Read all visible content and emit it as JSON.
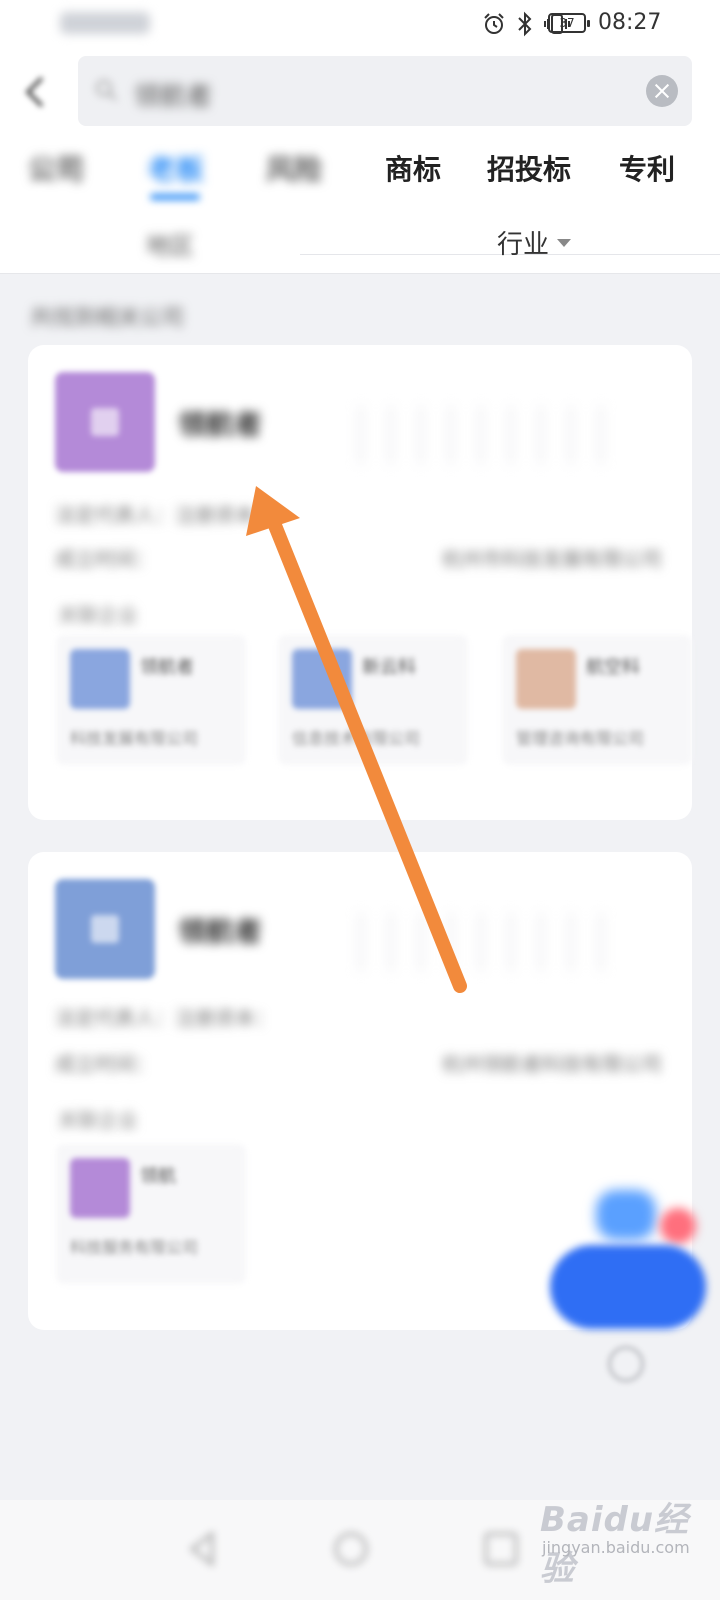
{
  "status_bar": {
    "time": "08:27",
    "battery": "37"
  },
  "search": {
    "query": "领航者"
  },
  "tabs": [
    {
      "label": "公司"
    },
    {
      "label": "老板"
    },
    {
      "label": "风险"
    },
    {
      "label": "商标"
    },
    {
      "label": "招投标"
    },
    {
      "label": "专利"
    }
  ],
  "filters": {
    "region": "地区",
    "industry": "行业"
  },
  "result_summary": "共找到相关公司",
  "cards": [
    {
      "name": "领航者",
      "line1": "法定代表人：注册资本：",
      "line2": "成立时间：",
      "line2_right": "杭州市科技发展有限公司",
      "section": "关联企业",
      "minis": [
        {
          "title": "领航者",
          "desc": "科技发展有限公司"
        },
        {
          "title": "新云科",
          "desc": "信息技术有限公司"
        },
        {
          "title": "航空科",
          "desc": "管理咨询有限公司"
        }
      ]
    },
    {
      "name": "领航者",
      "line1": "法定代表人：注册资本：",
      "line2": "成立时间：",
      "line2_right": "杭州领航者科技有限公司",
      "section": "关联企业",
      "minis": [
        {
          "title": "领航",
          "desc": "科技服务有限公司"
        }
      ]
    }
  ],
  "watermark": {
    "logo": "Baidu经验",
    "url": "jingyan.baidu.com"
  },
  "colors": {
    "accent": "#2b8cf6",
    "arrow": "#f28a3c",
    "fab": "#2f6ef4"
  }
}
